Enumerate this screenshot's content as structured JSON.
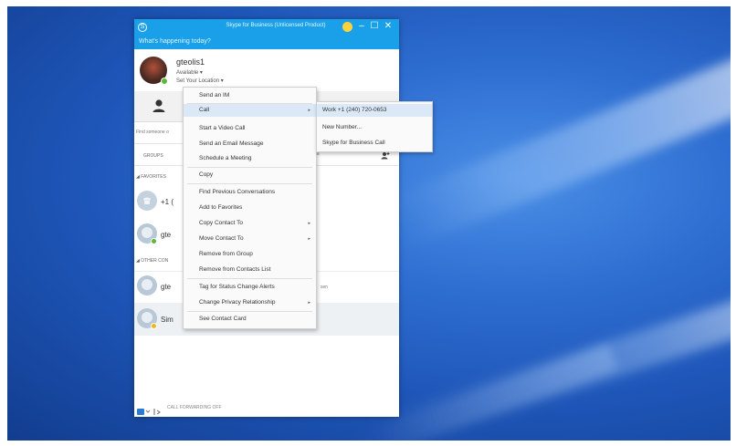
{
  "window": {
    "title": "Skype for Business (Unlicensed Product)",
    "tagline": "What's happening today?",
    "minimize": "–",
    "restore": "☐",
    "close": "✕"
  },
  "profile": {
    "name": "gteolis1",
    "status": "Available ▾",
    "location": "Set Your Location ▾"
  },
  "search": {
    "placeholder": "Find someone o"
  },
  "groups": {
    "label": "GROUPS",
    "favorites_header": "◢ FAVORITES",
    "other_contacts_header": "◢ OTHER CON"
  },
  "contacts": [
    {
      "name": "+1 ("
    },
    {
      "name": "gte"
    },
    {
      "name": "gte"
    },
    {
      "name": "Sim"
    }
  ],
  "contact_note": "sen",
  "context_menu": {
    "items": [
      {
        "label": "Send an IM",
        "arrow": ""
      },
      {
        "label": "Call",
        "arrow": "▸"
      },
      {
        "label": "Start a Video Call",
        "arrow": ""
      },
      {
        "label": "Send an Email Message",
        "arrow": ""
      },
      {
        "label": "Schedule a Meeting",
        "arrow": ""
      },
      {
        "label": "Copy",
        "arrow": ""
      },
      {
        "label": "Find Previous Conversations",
        "arrow": ""
      },
      {
        "label": "Add to Favorites",
        "arrow": ""
      },
      {
        "label": "Copy Contact To",
        "arrow": "▸"
      },
      {
        "label": "Move Contact To",
        "arrow": "▸"
      },
      {
        "label": "Remove from Group",
        "arrow": ""
      },
      {
        "label": "Remove from Contacts List",
        "arrow": ""
      },
      {
        "label": "Tag for Status Change Alerts",
        "arrow": ""
      },
      {
        "label": "Change Privacy Relationship",
        "arrow": "▸"
      },
      {
        "label": "See Contact Card",
        "arrow": ""
      }
    ]
  },
  "call_submenu": {
    "items": [
      {
        "label": "Work +1 (240) 720-0653"
      },
      {
        "label": "New Number..."
      },
      {
        "label": "Skype for Business Call"
      }
    ]
  },
  "bottom_bar": {
    "text": "CALL FORWARDING OFF"
  },
  "colors": {
    "accent": "#1aa0e8",
    "presence_available": "#5bb83a",
    "presence_away": "#f2b51b",
    "menu_highlight": "#dbe9f7",
    "desktop": "#1e56b8"
  }
}
